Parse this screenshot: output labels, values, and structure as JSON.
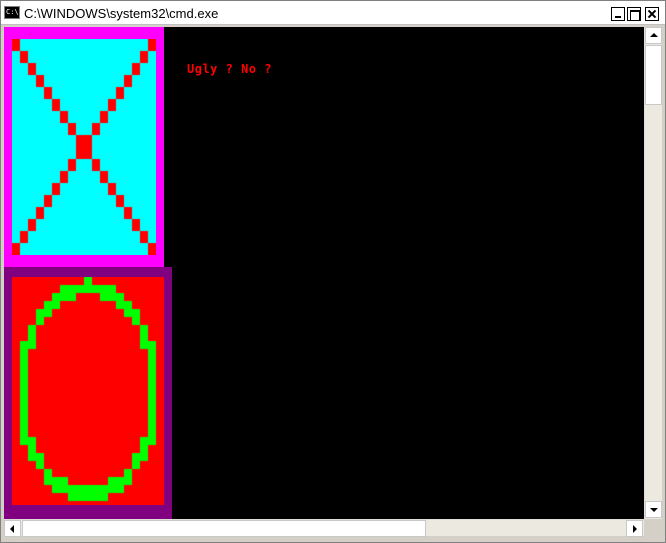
{
  "window": {
    "title": "C:\\WINDOWS\\system32\\cmd.exe",
    "icon": "cmd-icon",
    "icon_text": "C:\\"
  },
  "console": {
    "text": "Ugly ? No ?",
    "text_color": "#ff0000",
    "background": "#000000"
  },
  "panels": {
    "top": {
      "border_color": "#ff00ff",
      "fill_color": "#00ffff",
      "pattern_color": "#ff0000",
      "pattern": "x-cross"
    },
    "bottom": {
      "border_color": "#800080",
      "fill_color": "#ff0000",
      "pattern_color": "#00ff00",
      "pattern": "oval"
    }
  },
  "icons": [
    "minimize-icon",
    "maximize-icon",
    "close-icon",
    "arrow-up-icon",
    "arrow-down-icon",
    "arrow-left-icon",
    "arrow-right-icon"
  ]
}
